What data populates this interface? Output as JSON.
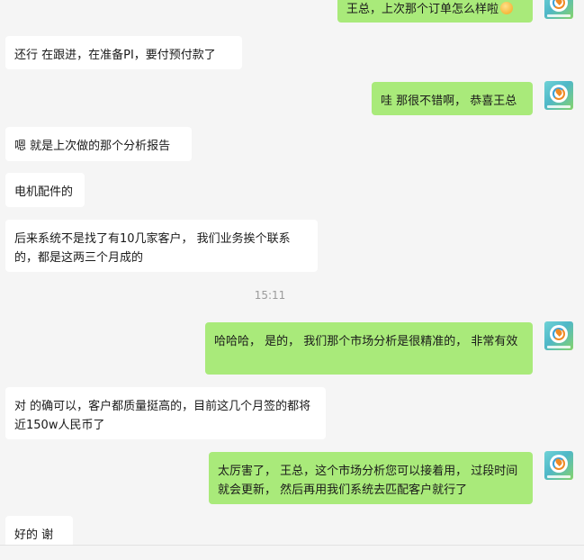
{
  "messages": [
    {
      "side": "out",
      "text": "王总，上次那个订单怎么样啦",
      "emoji": "biscuit-emoji"
    },
    {
      "side": "in",
      "text": "还行  在跟进，在准备PI，要付预付款了"
    },
    {
      "side": "out",
      "text": "哇 那很不错啊，  恭喜王总"
    },
    {
      "side": "in",
      "text": "嗯  就是上次做的那个分析报告"
    },
    {
      "side": "in",
      "text": "电机配件的"
    },
    {
      "side": "in",
      "text": "后来系统不是找了有10几家客户，  我们业务挨个联系的，都是这两三个月成的"
    },
    {
      "side": "out",
      "text": "哈哈哈，  是的，  我们那个市场分析是很精准的，  非常有效"
    },
    {
      "side": "in",
      "text": "对 的确可以，客户都质量挺高的，目前这几个月签的都将近150w人民币了"
    },
    {
      "side": "out",
      "text": "太厉害了，  王总，这个市场分析您可以接着用，  过段时间就会更新，  然后再用我们系统去匹配客户就行了"
    },
    {
      "side": "in",
      "text": "好的 谢谢"
    }
  ],
  "timestamp": "15:11",
  "colors": {
    "background": "#f5f5f5",
    "incoming_bubble": "#ffffff",
    "outgoing_bubble": "#a9ea7a"
  },
  "icons": {
    "avatar": "user-avatar-icon"
  }
}
